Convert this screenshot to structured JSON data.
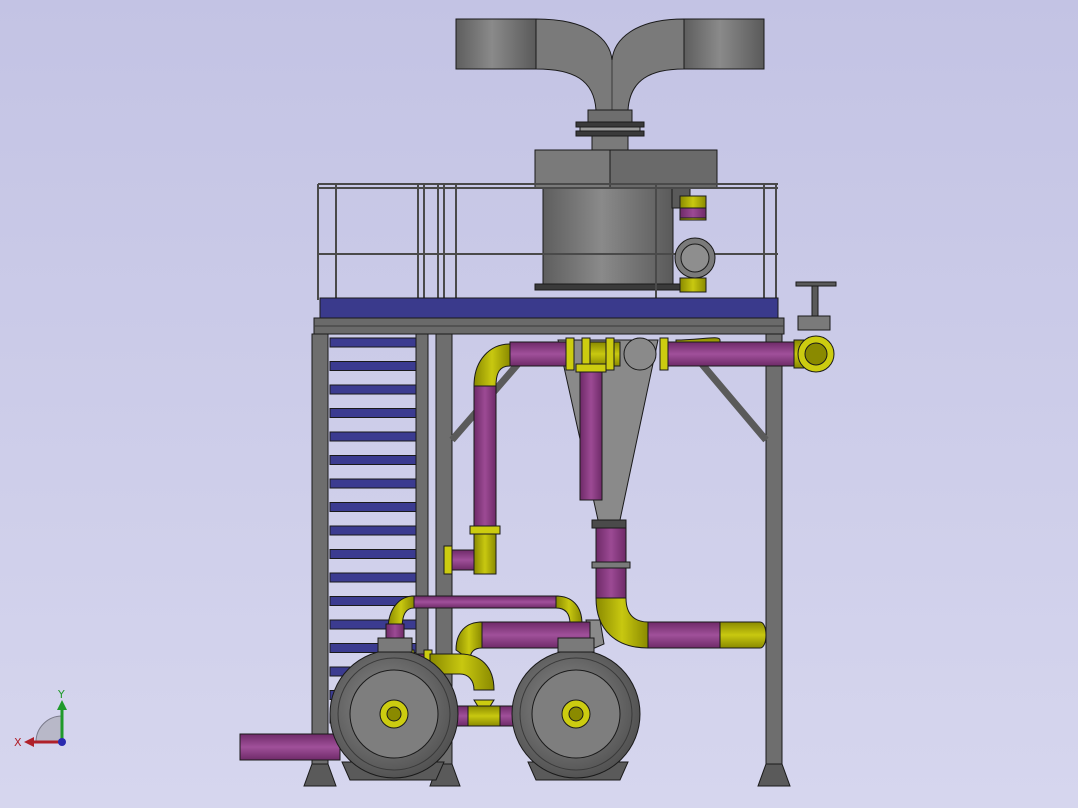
{
  "viewport": {
    "background_top": "#c3c3e4",
    "background_bottom": "#d6d6ee"
  },
  "colors": {
    "steel": "#7c7c7c",
    "steel_dark": "#4a4a4a",
    "steel_light": "#9a9a9a",
    "frame": "#6a6a6a",
    "deck": "#3a3a8c",
    "stair_tread": "#3b3b90",
    "pipe_magenta": "#8e3c86",
    "pipe_yellow": "#b3b300",
    "flange_yellow": "#cccc10",
    "outline": "#1a1a1a"
  },
  "triad": {
    "x_label": "X",
    "y_label": "Y",
    "x_color": "#b0202a",
    "y_color": "#1f9a2a",
    "z_color": "#2a2ab0"
  }
}
